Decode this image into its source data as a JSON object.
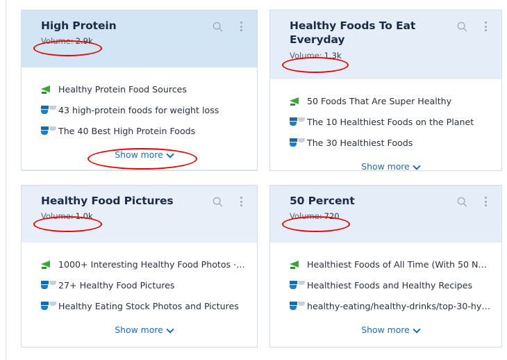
{
  "cards": [
    {
      "title": "High Protein",
      "volume_label": "Volume:",
      "volume_value": "2.9k",
      "search_icon": "search-icon",
      "menu_icon": "kebab-menu-icon",
      "items": [
        {
          "icon": "green-site-favicon",
          "label": "Healthy Protein Food Sources"
        },
        {
          "icon": "blue-site-favicon",
          "label": "43 high-protein foods for weight loss"
        },
        {
          "icon": "blue-site-favicon",
          "label": "The 40 Best High Protein Foods"
        }
      ],
      "show_more": "Show more",
      "show_more_icon": "chevron-down-icon"
    },
    {
      "title": "Healthy Foods To Eat Everyday",
      "volume_label": "Volume:",
      "volume_value": "1.3k",
      "search_icon": "search-icon",
      "menu_icon": "kebab-menu-icon",
      "items": [
        {
          "icon": "green-site-favicon",
          "label": "50 Foods That Are Super Healthy"
        },
        {
          "icon": "blue-site-favicon",
          "label": "The 10 Healthiest Foods on the Planet"
        },
        {
          "icon": "blue-site-favicon",
          "label": "The 30 Healthiest Foods"
        }
      ],
      "show_more": "Show more",
      "show_more_icon": "chevron-down-icon"
    },
    {
      "title": "Healthy Food Pictures",
      "volume_label": "Volume:",
      "volume_value": "1.0k",
      "search_icon": "search-icon",
      "menu_icon": "kebab-menu-icon",
      "items": [
        {
          "icon": "green-site-favicon",
          "label": "1000+ Interesting Healthy Food Photos · P…"
        },
        {
          "icon": "blue-site-favicon",
          "label": "27+ Healthy Food Pictures"
        },
        {
          "icon": "blue-site-favicon",
          "label": "Healthy Eating Stock Photos and Pictures"
        }
      ],
      "show_more": "Show more",
      "show_more_icon": "chevron-down-icon"
    },
    {
      "title": "50 Percent",
      "volume_label": "Volume:",
      "volume_value": "720",
      "search_icon": "search-icon",
      "menu_icon": "kebab-menu-icon",
      "items": [
        {
          "icon": "green-site-favicon",
          "label": "Healthiest Foods of All Time (With 50 Ne…"
        },
        {
          "icon": "blue-site-favicon",
          "label": "Healthiest Foods and Healthy Recipes"
        },
        {
          "icon": "blue-site-favicon",
          "label": "healthy-eating/healthy-drinks/top-30-hyd…"
        }
      ],
      "show_more": "Show more",
      "show_more_icon": "chevron-down-icon"
    }
  ],
  "colors": {
    "annotation": "#ee0000",
    "card_header_primary": "#d2e5f5",
    "card_header_secondary": "#e5eef8",
    "link": "#1f6bb5",
    "title": "#1c2b45"
  }
}
